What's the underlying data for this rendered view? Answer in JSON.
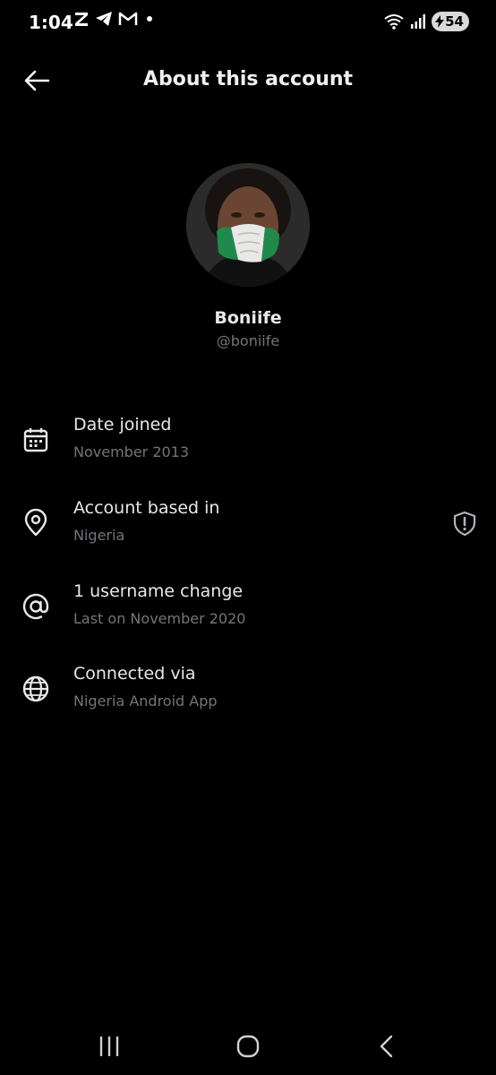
{
  "status_bar": {
    "time": "1:04",
    "left_icons": [
      "z-app-icon",
      "telegram-icon",
      "gmail-icon",
      "notification-dot"
    ],
    "right_icons": [
      "wifi-icon",
      "signal-icon"
    ],
    "battery_level": "54"
  },
  "header": {
    "title": "About this account",
    "back_icon": "back-arrow-icon"
  },
  "profile": {
    "display_name": "Boniife",
    "handle": "@boniife"
  },
  "info_rows": [
    {
      "icon": "calendar-icon",
      "title": "Date joined",
      "subtitle": "November 2013"
    },
    {
      "icon": "location-pin-icon",
      "title": "Account based in",
      "subtitle": "Nigeria",
      "trailing_icon": "shield-alert-icon"
    },
    {
      "icon": "at-sign-icon",
      "title": "1 username change",
      "subtitle": "Last on November 2020"
    },
    {
      "icon": "globe-icon",
      "title": "Connected via",
      "subtitle": "Nigeria Android App"
    }
  ],
  "nav_bar": [
    "recent-apps-icon",
    "home-icon",
    "back-icon"
  ],
  "colors": {
    "background": "#000000",
    "primary_text": "#e7e9ea",
    "secondary_text": "#71767b",
    "flag_green": "#1f8a4c"
  }
}
